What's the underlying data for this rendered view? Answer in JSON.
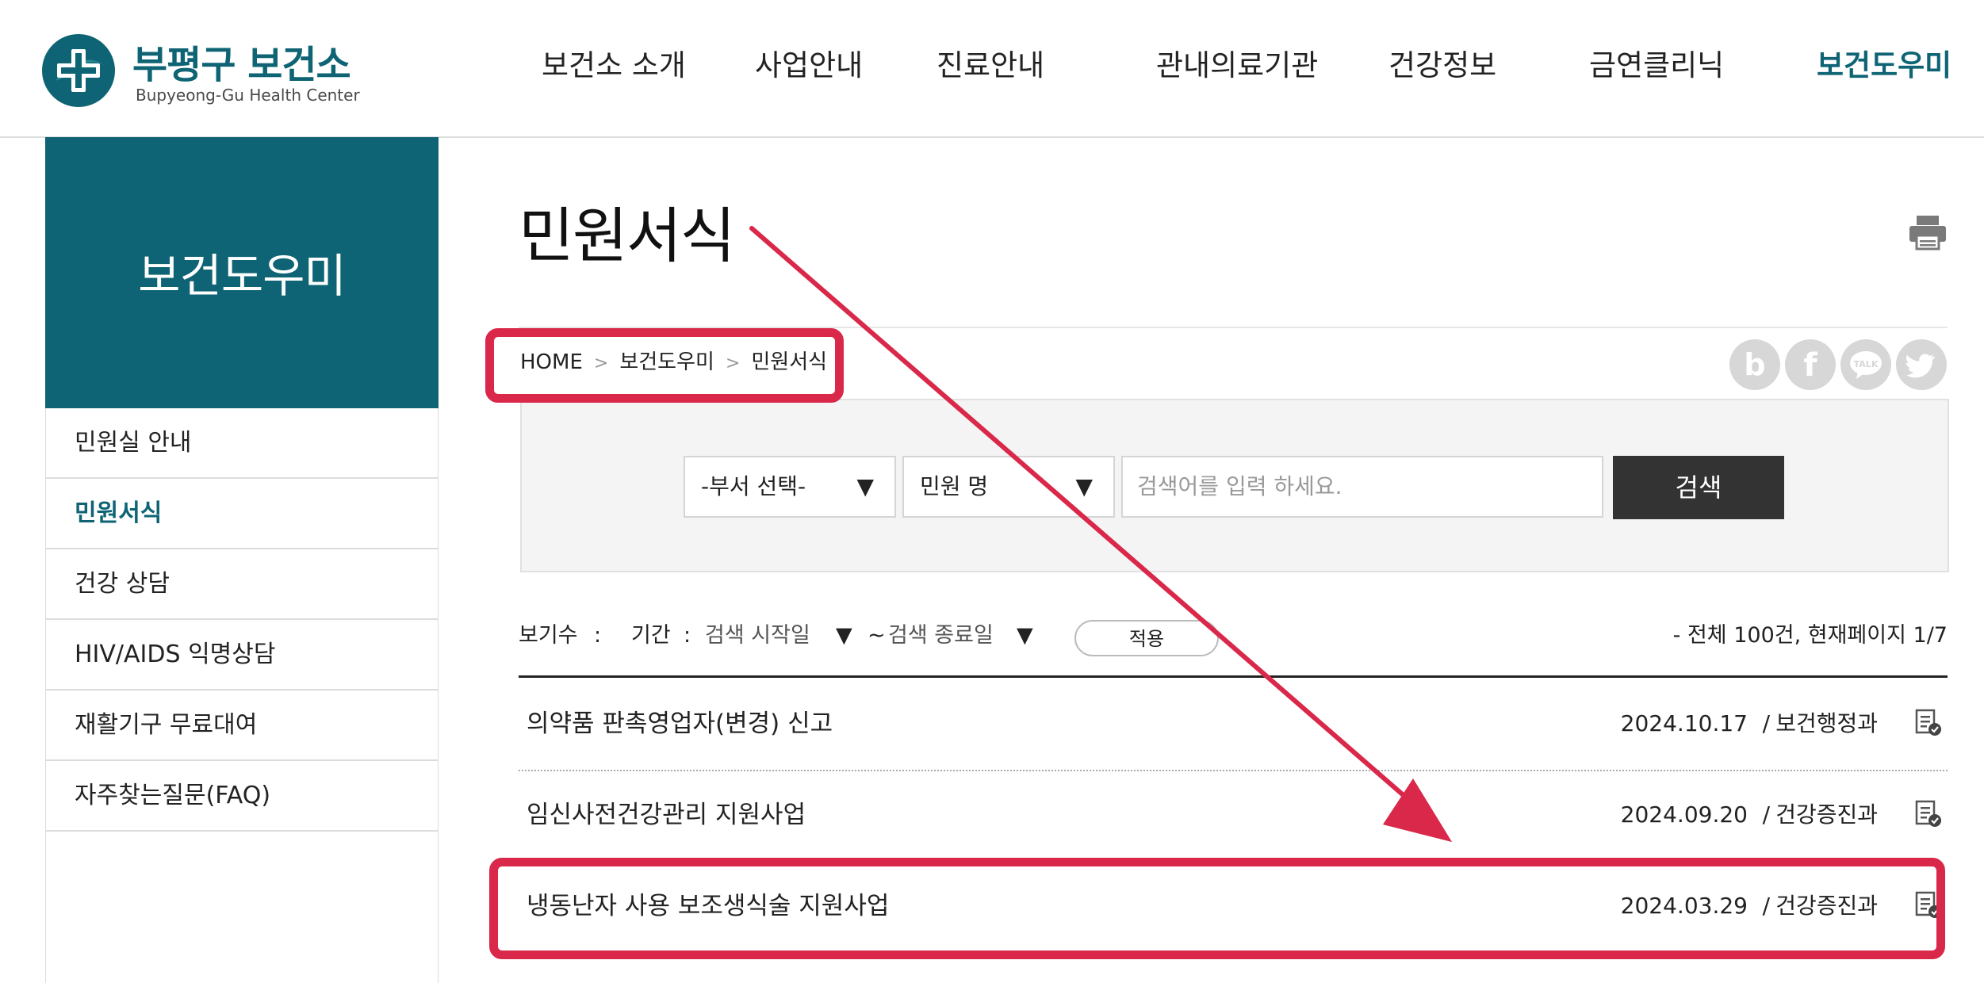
{
  "header": {
    "logo_ko": "부평구 보건소",
    "logo_en": "Bupyeong-Gu Health Center",
    "nav": [
      "보건소 소개",
      "사업안내",
      "진료안내",
      "관내의료기관",
      "건강정보",
      "금연클리닉",
      "보건도우미"
    ],
    "active_nav": "보건도우미"
  },
  "sidebar": {
    "title": "보건도우미",
    "items": [
      {
        "label": "민원실 안내"
      },
      {
        "label": "민원서식"
      },
      {
        "label": "건강 상담"
      },
      {
        "label": "HIV/AIDS 익명상담"
      },
      {
        "label": "재활기구 무료대여"
      },
      {
        "label": "자주찾는질문(FAQ)"
      }
    ],
    "active": "민원서식"
  },
  "content": {
    "title": "민원서식",
    "breadcrumb": [
      "HOME",
      "보건도우미",
      "민원서식"
    ],
    "share_icons": [
      "blog-icon",
      "facebook-icon",
      "kakaotalk-icon",
      "twitter-icon"
    ]
  },
  "search": {
    "dept_select": "-부서 선택-",
    "field_select": "민원 명",
    "placeholder": "검색어를 입력 하세요.",
    "button": "검색"
  },
  "filter": {
    "view_count_label": "보기수",
    "period_label": "기간",
    "start": "검색 시작일",
    "end": "검색 종료일",
    "tilde": "~",
    "apply": "적용",
    "total": "- 전체 100건, 현재페이지 1/7"
  },
  "rows": [
    {
      "title": "의약품 판촉영업자(변경) 신고",
      "date": "2024.10.17",
      "dept": "보건행정과"
    },
    {
      "title": "임신사전건강관리 지원사업",
      "date": "2024.09.20",
      "dept": "건강증진과"
    },
    {
      "title": "냉동난자 사용 보조생식술 지원사업",
      "date": "2024.03.29",
      "dept": "건강증진과"
    }
  ],
  "colors": {
    "brand": "#0e6474",
    "annotation": "#d9284a",
    "button_dark": "#333333"
  }
}
